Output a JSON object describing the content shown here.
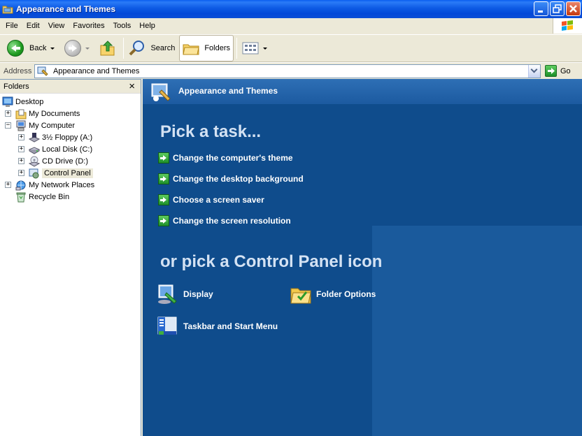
{
  "window": {
    "title": "Appearance and Themes"
  },
  "menu": [
    "File",
    "Edit",
    "View",
    "Favorites",
    "Tools",
    "Help"
  ],
  "toolbar": {
    "back": "Back",
    "search": "Search",
    "folders": "Folders"
  },
  "address": {
    "label": "Address",
    "value": "Appearance and Themes",
    "go": "Go"
  },
  "folders_pane": {
    "title": "Folders",
    "close": "×",
    "items": [
      {
        "label": "Desktop",
        "icon": "desktop-icon"
      },
      {
        "label": "My Documents",
        "icon": "my-documents-icon"
      },
      {
        "label": "My Computer",
        "icon": "my-computer-icon"
      },
      {
        "label": "3½ Floppy (A:)",
        "icon": "floppy-icon"
      },
      {
        "label": "Local Disk (C:)",
        "icon": "hard-disk-icon"
      },
      {
        "label": "CD Drive (D:)",
        "icon": "cd-drive-icon"
      },
      {
        "label": "Control Panel",
        "icon": "control-panel-icon"
      },
      {
        "label": "My Network Places",
        "icon": "network-icon"
      },
      {
        "label": "Recycle Bin",
        "icon": "recycle-bin-icon"
      }
    ],
    "expanders": {
      "plus": "+",
      "minus": "−"
    }
  },
  "main": {
    "header": "Appearance and Themes",
    "pick_task": "Pick a task...",
    "tasks": [
      "Change the computer's theme",
      "Change the desktop background",
      "Choose a screen saver",
      "Change the screen resolution"
    ],
    "pick_icon": "or pick a Control Panel icon",
    "icons": [
      {
        "label": "Display",
        "icon": "display-icon"
      },
      {
        "label": "Folder Options",
        "icon": "folder-options-icon"
      },
      {
        "label": "Taskbar and Start Menu",
        "icon": "taskbar-icon"
      }
    ]
  },
  "colors": {
    "title_bar": "#0349d8",
    "main_bg": "#0f4c8c",
    "task_arrow": "#1e8f2a"
  }
}
